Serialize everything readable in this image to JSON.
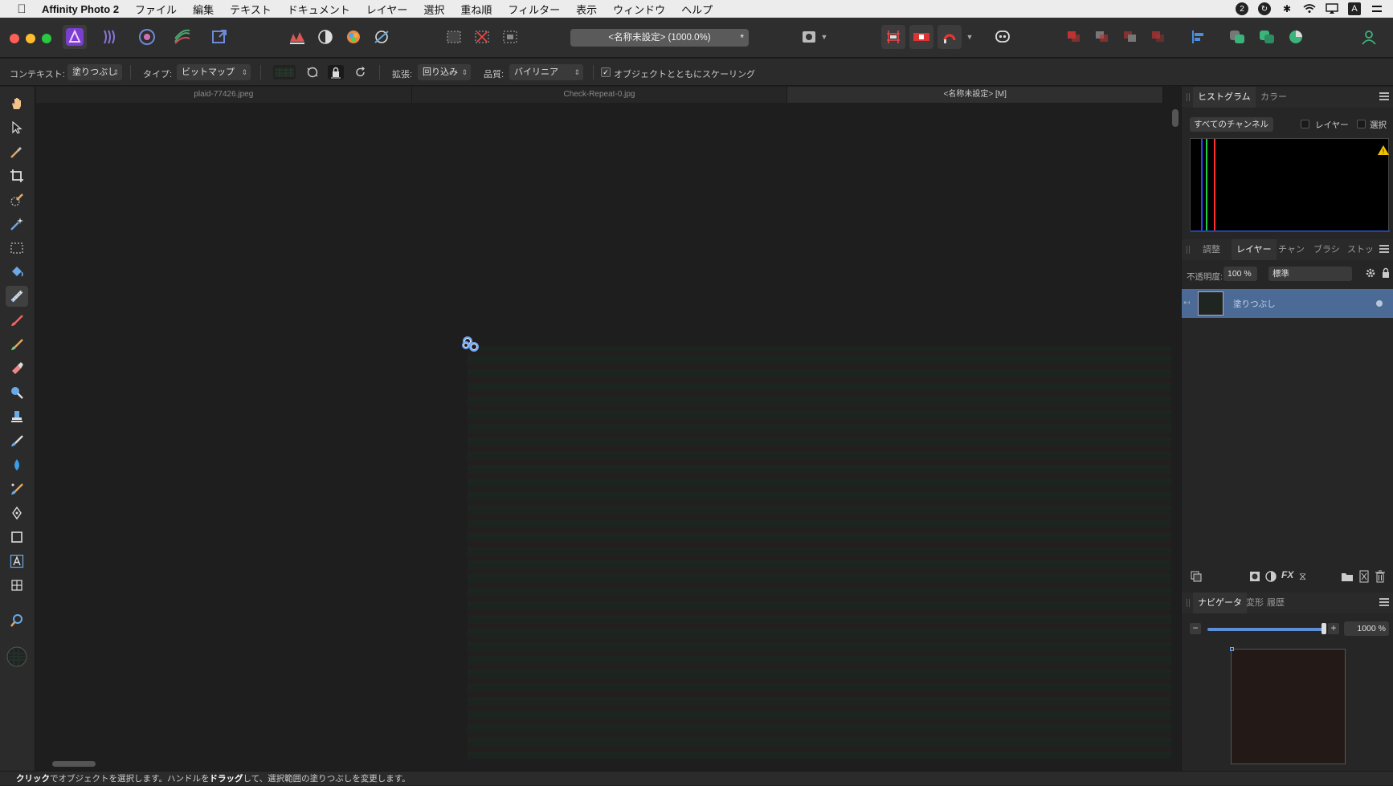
{
  "menubar": {
    "app_name": "Affinity Photo 2",
    "items": [
      "ファイル",
      "編集",
      "テキスト",
      "ドキュメント",
      "レイヤー",
      "選択",
      "重ね順",
      "フィルター",
      "表示",
      "ウィンドウ",
      "ヘルプ"
    ]
  },
  "toolbar": {
    "document_title": "<名称未設定> (1000.0%)",
    "modified_mark": "*"
  },
  "context": {
    "context_label": "コンテキスト:",
    "context_value": "塗りつぶし",
    "type_label": "タイプ:",
    "type_value": "ビットマップ",
    "extend_label": "拡張:",
    "extend_value": "回り込み",
    "quality_label": "品質:",
    "quality_value": "バイリニア",
    "scale_with_object_label": "オブジェクトとともにスケーリング",
    "scale_with_object_checked": true
  },
  "doc_tabs": [
    "plaid-77426.jpeg",
    "Check-Repeat-0.jpg",
    "<名称未設定> [M]"
  ],
  "active_doc_tab": 2,
  "histogram_panel": {
    "tabs": [
      "ヒストグラム",
      "カラー"
    ],
    "channel": "すべてのチャンネル",
    "layer_label": "レイヤー",
    "selection_label": "選択"
  },
  "layers_panel": {
    "tabs": [
      "調整",
      "レイヤー",
      "チャン",
      "ブラシ",
      "ストッ"
    ],
    "opacity_label": "不透明度:",
    "opacity_value": "100 %",
    "blend_mode": "標準",
    "layers": [
      {
        "name": "塗りつぶし"
      }
    ]
  },
  "navigator_panel": {
    "tabs": [
      "ナビゲータ",
      "変形",
      "履歴"
    ],
    "zoom_value": "1000 %",
    "zoom_slider_fraction": 1.0
  },
  "status": {
    "click_word": "クリック",
    "text_1": "でオブジェクトを選択します。ハンドルを",
    "drag_word": "ドラッグ",
    "text_2": "して、選択範囲の塗りつぶしを変更します。"
  },
  "colors": {
    "accent": "#4b6b96",
    "handle": "#6ea8ff",
    "canvas_bg": "#1e1e1e"
  }
}
